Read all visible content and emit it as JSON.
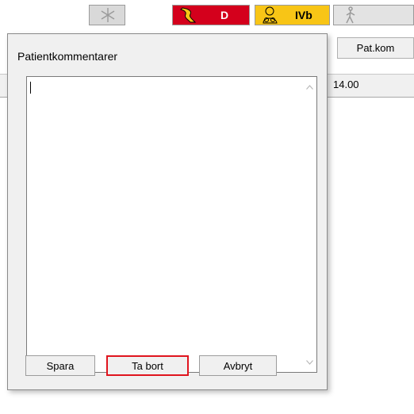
{
  "toolbar": {
    "d_label": "D",
    "ivb_label": "IVb",
    "patkom_label": "Pat.kom"
  },
  "background_row": {
    "time_value": "14.00"
  },
  "dialog": {
    "title": "Patientkommentarer",
    "comment_value": "",
    "buttons": {
      "save": "Spara",
      "delete": "Ta bort",
      "cancel": "Avbryt"
    }
  },
  "colors": {
    "status_red": "#d4001c",
    "status_yellow": "#f8c516",
    "highlight_red": "#e0141e"
  },
  "icons": [
    "snowflake-icon",
    "patient-lying-icon",
    "patient-sitting-icon",
    "walking-person-icon",
    "scroll-up-icon",
    "scroll-down-icon"
  ]
}
